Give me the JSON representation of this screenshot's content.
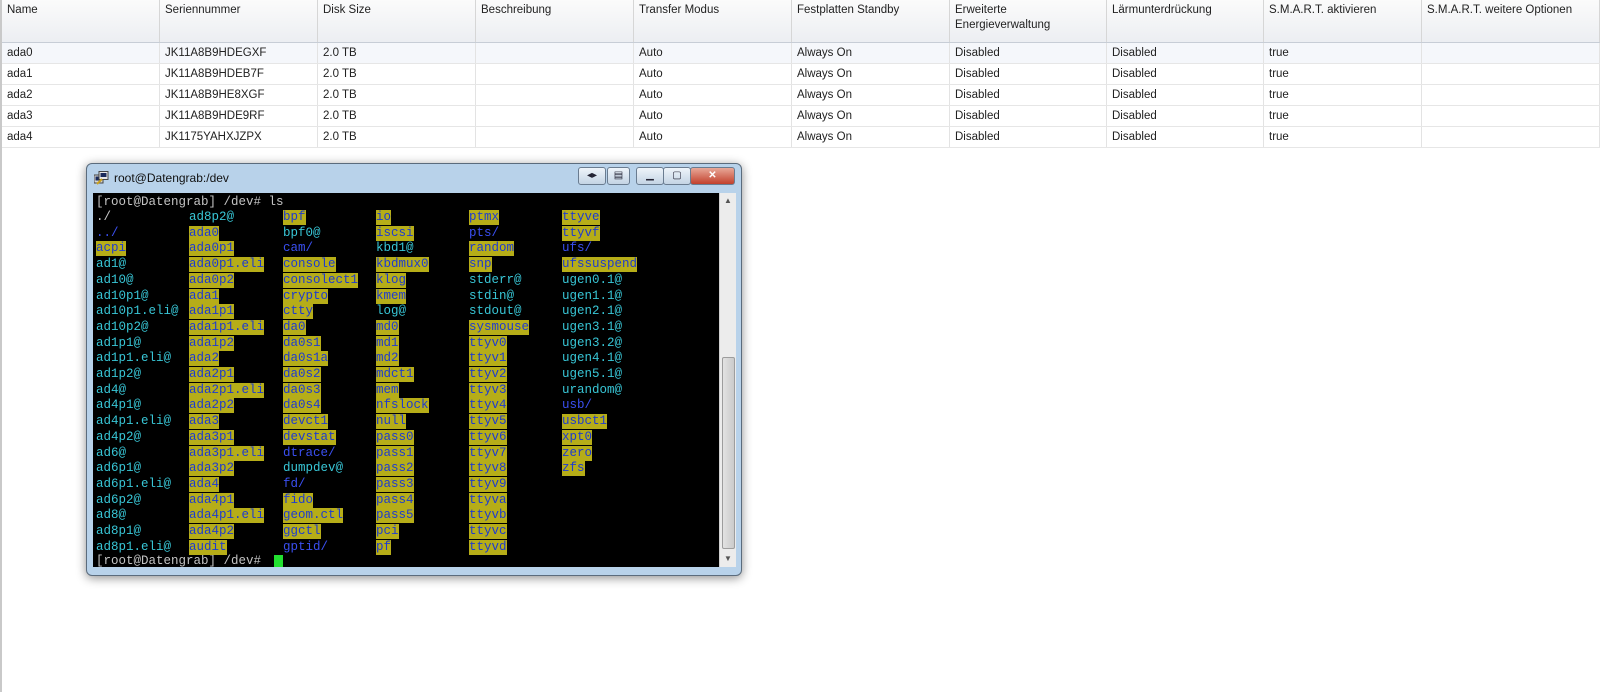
{
  "table": {
    "columns": [
      "Name",
      "Seriennummer",
      "Disk Size",
      "Beschreibung",
      "Transfer Modus",
      "Festplatten Standby",
      "Erweiterte Energieverwaltung",
      "Lärmunterdrückung",
      "S.M.A.R.T. aktivieren",
      "S.M.A.R.T. weitere Optionen"
    ],
    "rows": [
      [
        "ada0",
        "JK11A8B9HDEGXF",
        "2.0 TB",
        "",
        "Auto",
        "Always On",
        "Disabled",
        "Disabled",
        "true",
        ""
      ],
      [
        "ada1",
        "JK11A8B9HDEB7F",
        "2.0 TB",
        "",
        "Auto",
        "Always On",
        "Disabled",
        "Disabled",
        "true",
        ""
      ],
      [
        "ada2",
        "JK11A8B9HE8XGF",
        "2.0 TB",
        "",
        "Auto",
        "Always On",
        "Disabled",
        "Disabled",
        "true",
        ""
      ],
      [
        "ada3",
        "JK11A8B9HDE9RF",
        "2.0 TB",
        "",
        "Auto",
        "Always On",
        "Disabled",
        "Disabled",
        "true",
        ""
      ],
      [
        "ada4",
        "JK1175YAHXJZPX",
        "2.0 TB",
        "",
        "Auto",
        "Always On",
        "Disabled",
        "Disabled",
        "true",
        ""
      ]
    ]
  },
  "terminal": {
    "title": "root@Datengrab:/dev",
    "prompt_cmd": "[root@Datengrab] /dev# ls",
    "prompt": "[root@Datengrab] /dev#",
    "columns": [
      [
        [
          "./",
          "plain"
        ],
        [
          "../",
          "dir"
        ],
        [
          "acpi",
          "hl"
        ],
        [
          "ad1@",
          "ln"
        ],
        [
          "ad10@",
          "ln"
        ],
        [
          "ad10p1@",
          "ln"
        ],
        [
          "ad10p1.eli@",
          "ln"
        ],
        [
          "ad10p2@",
          "ln"
        ],
        [
          "ad1p1@",
          "ln"
        ],
        [
          "ad1p1.eli@",
          "ln"
        ],
        [
          "ad1p2@",
          "ln"
        ],
        [
          "ad4@",
          "ln"
        ],
        [
          "ad4p1@",
          "ln"
        ],
        [
          "ad4p1.eli@",
          "ln"
        ],
        [
          "ad4p2@",
          "ln"
        ],
        [
          "ad6@",
          "ln"
        ],
        [
          "ad6p1@",
          "ln"
        ],
        [
          "ad6p1.eli@",
          "ln"
        ],
        [
          "ad6p2@",
          "ln"
        ],
        [
          "ad8@",
          "ln"
        ],
        [
          "ad8p1@",
          "ln"
        ],
        [
          "ad8p1.eli@",
          "ln"
        ]
      ],
      [
        [
          "ad8p2@",
          "ln"
        ],
        [
          "ada0",
          "hl"
        ],
        [
          "ada0p1",
          "hl"
        ],
        [
          "ada0p1.eli",
          "hl"
        ],
        [
          "ada0p2",
          "hl"
        ],
        [
          "ada1",
          "hl"
        ],
        [
          "ada1p1",
          "hl"
        ],
        [
          "ada1p1.eli",
          "hl"
        ],
        [
          "ada1p2",
          "hl"
        ],
        [
          "ada2",
          "hl"
        ],
        [
          "ada2p1",
          "hl"
        ],
        [
          "ada2p1.eli",
          "hl"
        ],
        [
          "ada2p2",
          "hl"
        ],
        [
          "ada3",
          "hl"
        ],
        [
          "ada3p1",
          "hl"
        ],
        [
          "ada3p1.eli",
          "hl"
        ],
        [
          "ada3p2",
          "hl"
        ],
        [
          "ada4",
          "hl"
        ],
        [
          "ada4p1",
          "hl"
        ],
        [
          "ada4p1.eli",
          "hl"
        ],
        [
          "ada4p2",
          "hl"
        ],
        [
          "audit",
          "hl"
        ]
      ],
      [
        [
          "bpf",
          "hl"
        ],
        [
          "bpf0@",
          "ln"
        ],
        [
          "cam/",
          "dir"
        ],
        [
          "console",
          "hl"
        ],
        [
          "consolect1",
          "hl"
        ],
        [
          "crypto",
          "hl"
        ],
        [
          "ctty",
          "hl"
        ],
        [
          "da0",
          "hl"
        ],
        [
          "da0s1",
          "hl"
        ],
        [
          "da0s1a",
          "hl"
        ],
        [
          "da0s2",
          "hl"
        ],
        [
          "da0s3",
          "hl"
        ],
        [
          "da0s4",
          "hl"
        ],
        [
          "devct1",
          "hl"
        ],
        [
          "devstat",
          "hl"
        ],
        [
          "dtrace/",
          "dir"
        ],
        [
          "dumpdev@",
          "ln"
        ],
        [
          "fd/",
          "dir"
        ],
        [
          "fido",
          "hl"
        ],
        [
          "geom.ctl",
          "hl"
        ],
        [
          "ggctl",
          "hl"
        ],
        [
          "gptid/",
          "dir"
        ]
      ],
      [
        [
          "io",
          "hl"
        ],
        [
          "iscsi",
          "hl"
        ],
        [
          "kbd1@",
          "ln"
        ],
        [
          "kbdmux0",
          "hl"
        ],
        [
          "klog",
          "hl"
        ],
        [
          "kmem",
          "hl"
        ],
        [
          "log@",
          "ln"
        ],
        [
          "md0",
          "hl"
        ],
        [
          "md1",
          "hl"
        ],
        [
          "md2",
          "hl"
        ],
        [
          "mdct1",
          "hl"
        ],
        [
          "mem",
          "hl"
        ],
        [
          "nfslock",
          "hl"
        ],
        [
          "null",
          "hl"
        ],
        [
          "pass0",
          "hl"
        ],
        [
          "pass1",
          "hl"
        ],
        [
          "pass2",
          "hl"
        ],
        [
          "pass3",
          "hl"
        ],
        [
          "pass4",
          "hl"
        ],
        [
          "pass5",
          "hl"
        ],
        [
          "pci",
          "hl"
        ],
        [
          "pf",
          "hl"
        ]
      ],
      [
        [
          "ptmx",
          "hl"
        ],
        [
          "pts/",
          "dir"
        ],
        [
          "random",
          "hl"
        ],
        [
          "snp",
          "hl"
        ],
        [
          "stderr@",
          "ln"
        ],
        [
          "stdin@",
          "ln"
        ],
        [
          "stdout@",
          "ln"
        ],
        [
          "sysmouse",
          "hl"
        ],
        [
          "ttyv0",
          "hl"
        ],
        [
          "ttyv1",
          "hl"
        ],
        [
          "ttyv2",
          "hl"
        ],
        [
          "ttyv3",
          "hl"
        ],
        [
          "ttyv4",
          "hl"
        ],
        [
          "ttyv5",
          "hl"
        ],
        [
          "ttyv6",
          "hl"
        ],
        [
          "ttyv7",
          "hl"
        ],
        [
          "ttyv8",
          "hl"
        ],
        [
          "ttyv9",
          "hl"
        ],
        [
          "ttyva",
          "hl"
        ],
        [
          "ttyvb",
          "hl"
        ],
        [
          "ttyvc",
          "hl"
        ],
        [
          "ttyvd",
          "hl"
        ]
      ],
      [
        [
          "ttyve",
          "hl"
        ],
        [
          "ttyvf",
          "hl"
        ],
        [
          "ufs/",
          "dir"
        ],
        [
          "ufssuspend",
          "hl"
        ],
        [
          "ugen0.1@",
          "ln"
        ],
        [
          "ugen1.1@",
          "ln"
        ],
        [
          "ugen2.1@",
          "ln"
        ],
        [
          "ugen3.1@",
          "ln"
        ],
        [
          "ugen3.2@",
          "ln"
        ],
        [
          "ugen4.1@",
          "ln"
        ],
        [
          "ugen5.1@",
          "ln"
        ],
        [
          "urandom@",
          "ln"
        ],
        [
          "usb/",
          "dir"
        ],
        [
          "usbct1",
          "hl"
        ],
        [
          "xpt0",
          "hl"
        ],
        [
          "zero",
          "hl"
        ],
        [
          "zfs",
          "hl"
        ]
      ]
    ]
  },
  "colors": {
    "highlight_bg": "#b6ad18",
    "symlink": "#38c6d6",
    "directory": "#3a4ff0",
    "cursor": "#22e030"
  }
}
